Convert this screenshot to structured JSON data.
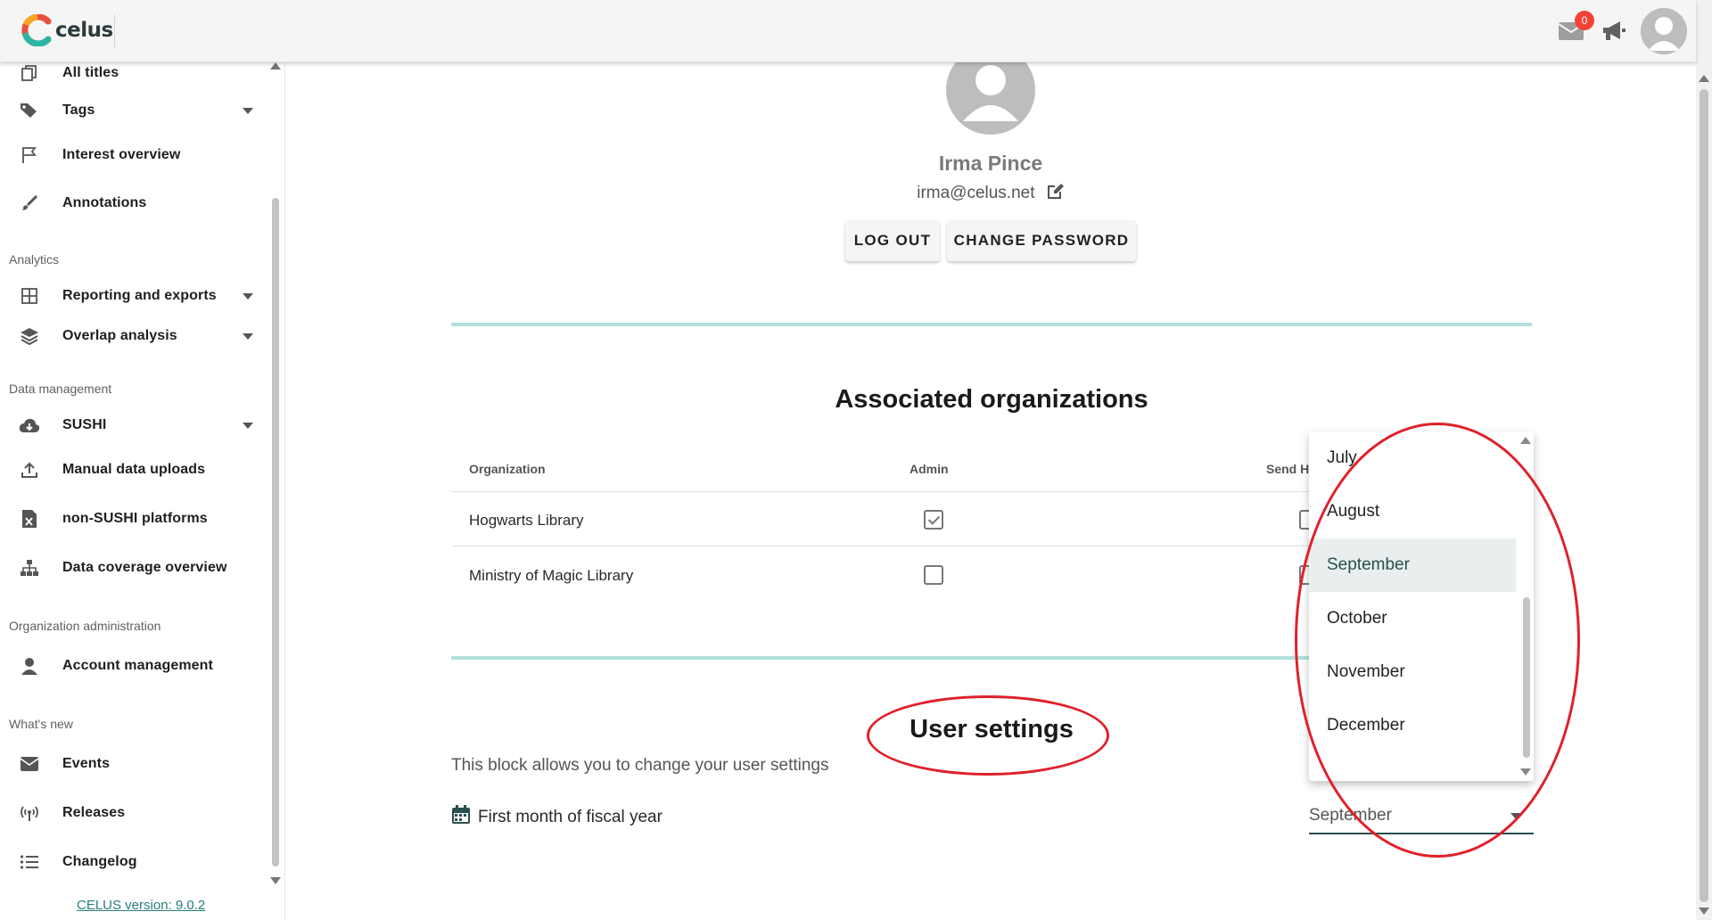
{
  "app": {
    "logo_text": "celus"
  },
  "header": {
    "notifications_count": "0"
  },
  "sidebar": {
    "items": [
      {
        "label": "All titles",
        "icon": "copy-icon"
      },
      {
        "label": "Tags",
        "icon": "tags-icon",
        "has_caret": true
      },
      {
        "label": "Interest overview",
        "icon": "flag-icon"
      },
      {
        "label": "Annotations",
        "icon": "brush-icon"
      },
      {
        "label": "Reporting and exports",
        "icon": "grid-icon",
        "has_caret": true
      },
      {
        "label": "Overlap analysis",
        "icon": "layers-icon",
        "has_caret": true
      },
      {
        "label": "SUSHI",
        "icon": "cloud-download-icon",
        "has_caret": true
      },
      {
        "label": "Manual data uploads",
        "icon": "upload-icon"
      },
      {
        "label": "non-SUSHI platforms",
        "icon": "file-excel-icon"
      },
      {
        "label": "Data coverage overview",
        "icon": "sitemap-icon"
      },
      {
        "label": "Account management",
        "icon": "user-icon"
      },
      {
        "label": "Events",
        "icon": "envelope-icon"
      },
      {
        "label": "Releases",
        "icon": "broadcast-icon"
      },
      {
        "label": "Changelog",
        "icon": "list-icon"
      }
    ],
    "headers": [
      "Analytics",
      "Data management",
      "Organization administration",
      "What's new"
    ],
    "version": "CELUS version: 9.0.2"
  },
  "profile": {
    "name": "Irma Pince",
    "email": "irma@celus.net",
    "logout_label": "LOG OUT",
    "change_password_label": "CHANGE PASSWORD"
  },
  "organizations": {
    "title": "Associated organizations",
    "columns": [
      "Organization",
      "Admin",
      "Send H"
    ],
    "rows": [
      {
        "name": "Hogwarts Library",
        "admin": true,
        "send": false
      },
      {
        "name": "Ministry of Magic Library",
        "admin": false,
        "send": false
      }
    ]
  },
  "user_settings": {
    "title": "User settings",
    "description": "This block allows you to change your user settings",
    "fiscal_label": "First month of fiscal year",
    "fiscal_value": "September",
    "dropdown_options": [
      "July",
      "August",
      "September",
      "October",
      "November",
      "December"
    ],
    "selected_option": "September"
  },
  "colors": {
    "accent": "#2a4f4e",
    "divider": "#b2dfdb",
    "link": "#2a7d7b",
    "annotation": "#e0202a",
    "badge": "#f44336"
  }
}
